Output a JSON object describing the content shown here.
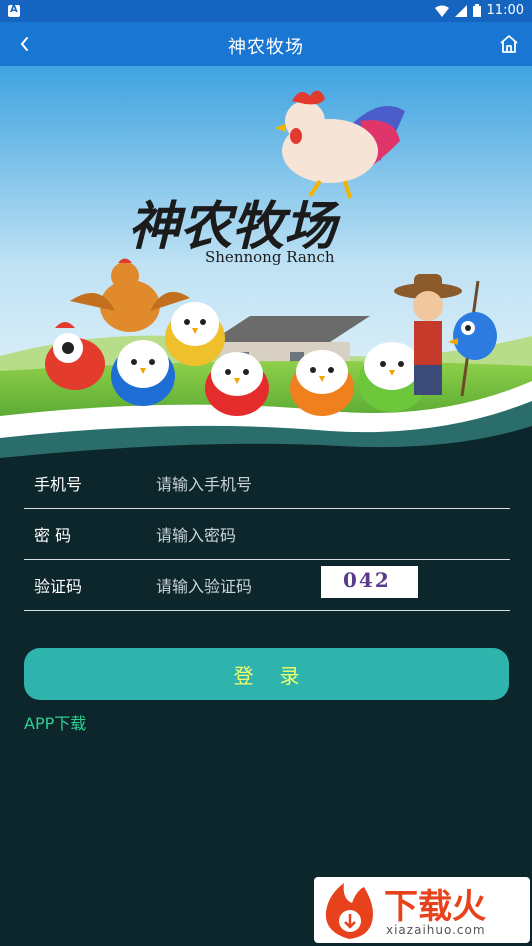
{
  "status_bar": {
    "time": "11:00",
    "app_indicator": "A"
  },
  "titlebar": {
    "title": "神农牧场",
    "back_icon": "chevron-left",
    "home_icon": "home"
  },
  "banner": {
    "logo_text": "神农牧场",
    "logo_subtitle": "Shennong Ranch"
  },
  "form": {
    "phone": {
      "label": "手机号",
      "placeholder": "请输入手机号"
    },
    "password": {
      "label": "密 码",
      "placeholder": "请输入密码"
    },
    "captcha": {
      "label": "验证码",
      "placeholder": "请输入验证码",
      "image_text": "042"
    }
  },
  "login_button": {
    "label": "登录"
  },
  "app_download": {
    "label": "APP下载"
  },
  "watermark": {
    "main": "下载火",
    "sub": "xiazaihuo.com"
  },
  "colors": {
    "statusbar": "#1565c0",
    "titlebar": "#1976d2",
    "background": "#0c262b",
    "button": "#2eb3ad",
    "button_text": "#f4ff6a",
    "link": "#2ed090"
  }
}
